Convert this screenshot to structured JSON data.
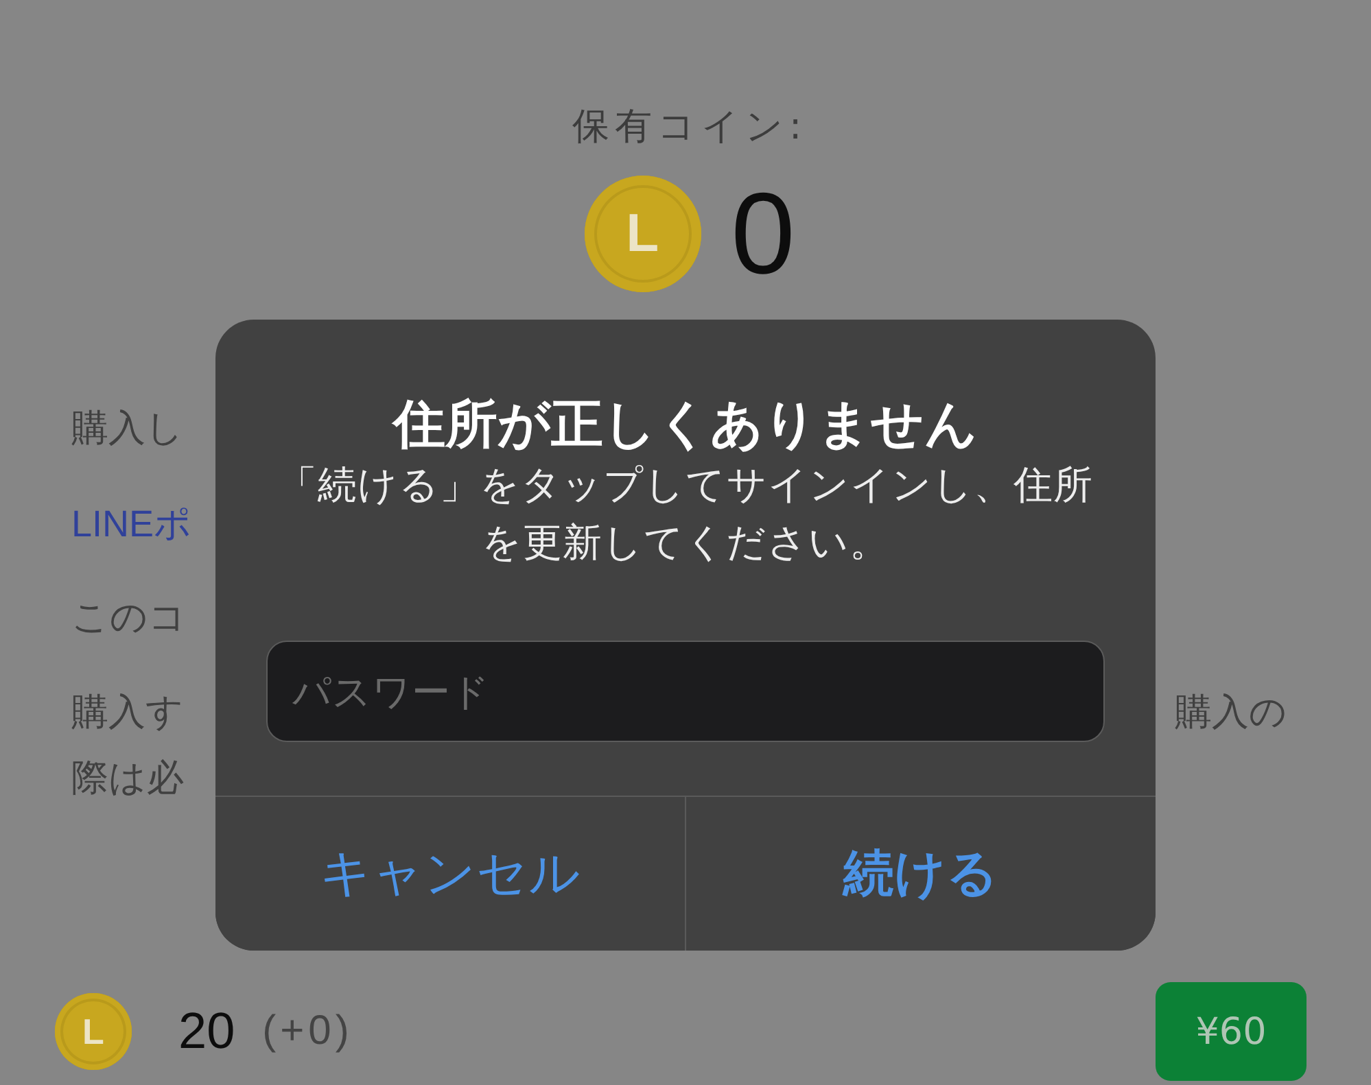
{
  "balance": {
    "label": "保有コイン:",
    "coin_letter": "L",
    "amount": "0"
  },
  "paragraphs": [
    {
      "kind": "text",
      "lines": [
        {
          "left": "購入し"
        }
      ]
    },
    {
      "kind": "link",
      "lines": [
        {
          "left": "LINEポ"
        }
      ]
    },
    {
      "kind": "text",
      "lines": [
        {
          "left": "このコ"
        }
      ]
    },
    {
      "kind": "text",
      "lines": [
        {
          "left": "購入す",
          "right": "購入の"
        },
        {
          "left": "際は必"
        }
      ]
    }
  ],
  "dialog": {
    "title": "住所が正しくありません",
    "message": "「続ける」をタップしてサインインし、住所を更新してください。",
    "password_field": {
      "placeholder": "パスワード"
    },
    "buttons": [
      {
        "label": "キャンセル",
        "kind": "cancel"
      },
      {
        "label": "続ける",
        "kind": "default"
      }
    ]
  },
  "coin_pack": {
    "coin_letter": "L",
    "amount": "20",
    "bonus": "(+0)",
    "price": "¥60"
  }
}
